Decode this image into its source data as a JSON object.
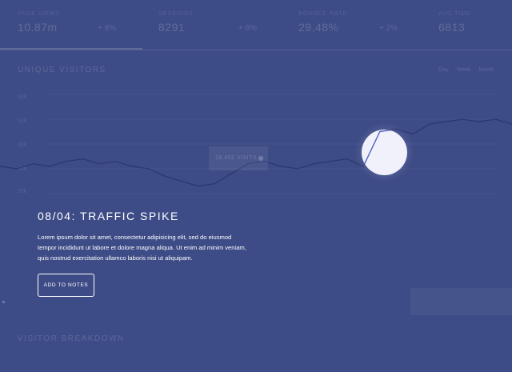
{
  "colors": {
    "background": "#3d4b86",
    "spotlight": "#f0f1fb",
    "spotlight_line": "#4e63c2",
    "text": "#ffffff"
  },
  "stats": [
    {
      "label": "PAGE VIEWS",
      "value": "10.87m",
      "delta": "+ 8%"
    },
    {
      "label": "SESSIONS",
      "value": "8291",
      "delta": "+ 6%"
    },
    {
      "label": "BOUNCE RATE",
      "value": "29.48%",
      "delta": "+ 2%"
    },
    {
      "label": "AVG TIME",
      "value": "6813",
      "delta": ""
    }
  ],
  "chart_section": {
    "title": "UNIQUE VISITORS",
    "ranges": [
      "Day",
      "Week",
      "Month"
    ],
    "y_labels": [
      "60k",
      "50k",
      "40k",
      "30k",
      "20k"
    ],
    "ghost_tooltip_text": "18,402 VISITS"
  },
  "callout": {
    "title": "08/04: TRAFFIC SPIKE",
    "body": "Lorem ipsum dolor sit amet, consectetur adipisicing elit, sed do eiusmod tempor incididunt ut labore et dolore magna aliqua. Ut enim ad minim veniam, quis nostrud exercitation ullamco laboris nisi ut aliquipam.",
    "button_label": "ADD TO NOTES"
  },
  "breakdown_section": {
    "title": "VISITOR BREAKDOWN"
  },
  "chart_data": {
    "type": "line",
    "x": [
      0,
      1,
      2,
      3,
      4,
      5,
      6,
      7,
      8,
      9,
      10,
      11,
      12,
      13,
      14,
      15,
      16,
      17,
      18,
      19,
      20,
      21,
      22,
      23,
      24,
      25,
      26,
      27,
      28,
      29,
      30,
      31
    ],
    "y": [
      31,
      30,
      32,
      31,
      33,
      34,
      32,
      33,
      31,
      30,
      27,
      25,
      23,
      24,
      28,
      32,
      33,
      31,
      30,
      32,
      33,
      34,
      31,
      45,
      46,
      44,
      48,
      49,
      50,
      49,
      50,
      48
    ],
    "ylim": [
      20,
      60
    ],
    "title": "",
    "xlabel": "",
    "ylabel": ""
  }
}
